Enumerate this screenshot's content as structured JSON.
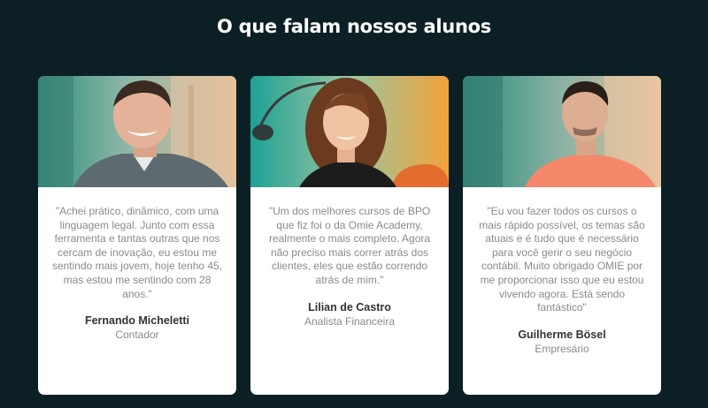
{
  "section": {
    "title": "O que falam nossos alunos"
  },
  "testimonials": [
    {
      "quote": "\"Achei prático, dinâmico, com uma linguagem legal. Junto com essa ferramenta e tantas outras que nos cercam de inovação, eu estou me sentindo mais jovem, hoje tenho 45, mas estou me sentindo com 28 anos.\"",
      "name": "Fernando Micheletti",
      "role": "Contador"
    },
    {
      "quote": "\"Um dos melhores cursos de BPO que fiz foi o da Omie Academy, realmente o mais completo. Agora não preciso mais correr atrás dos clientes, eles que estão correndo atrás de mim.\"",
      "name": "Lilian de Castro",
      "role": "Analista Financeira"
    },
    {
      "quote": "\"Eu vou fazer todos os cursos o mais rápido possível, os temas são atuais e é tudo que é necessário para você gerir o seu negócio contábil. Muito obrigado OMIE por me proporcionar isso que eu estou vivendo agora. Está sendo fantástico\"",
      "name": "Guilherme Bösel",
      "role": "Empresário"
    }
  ]
}
